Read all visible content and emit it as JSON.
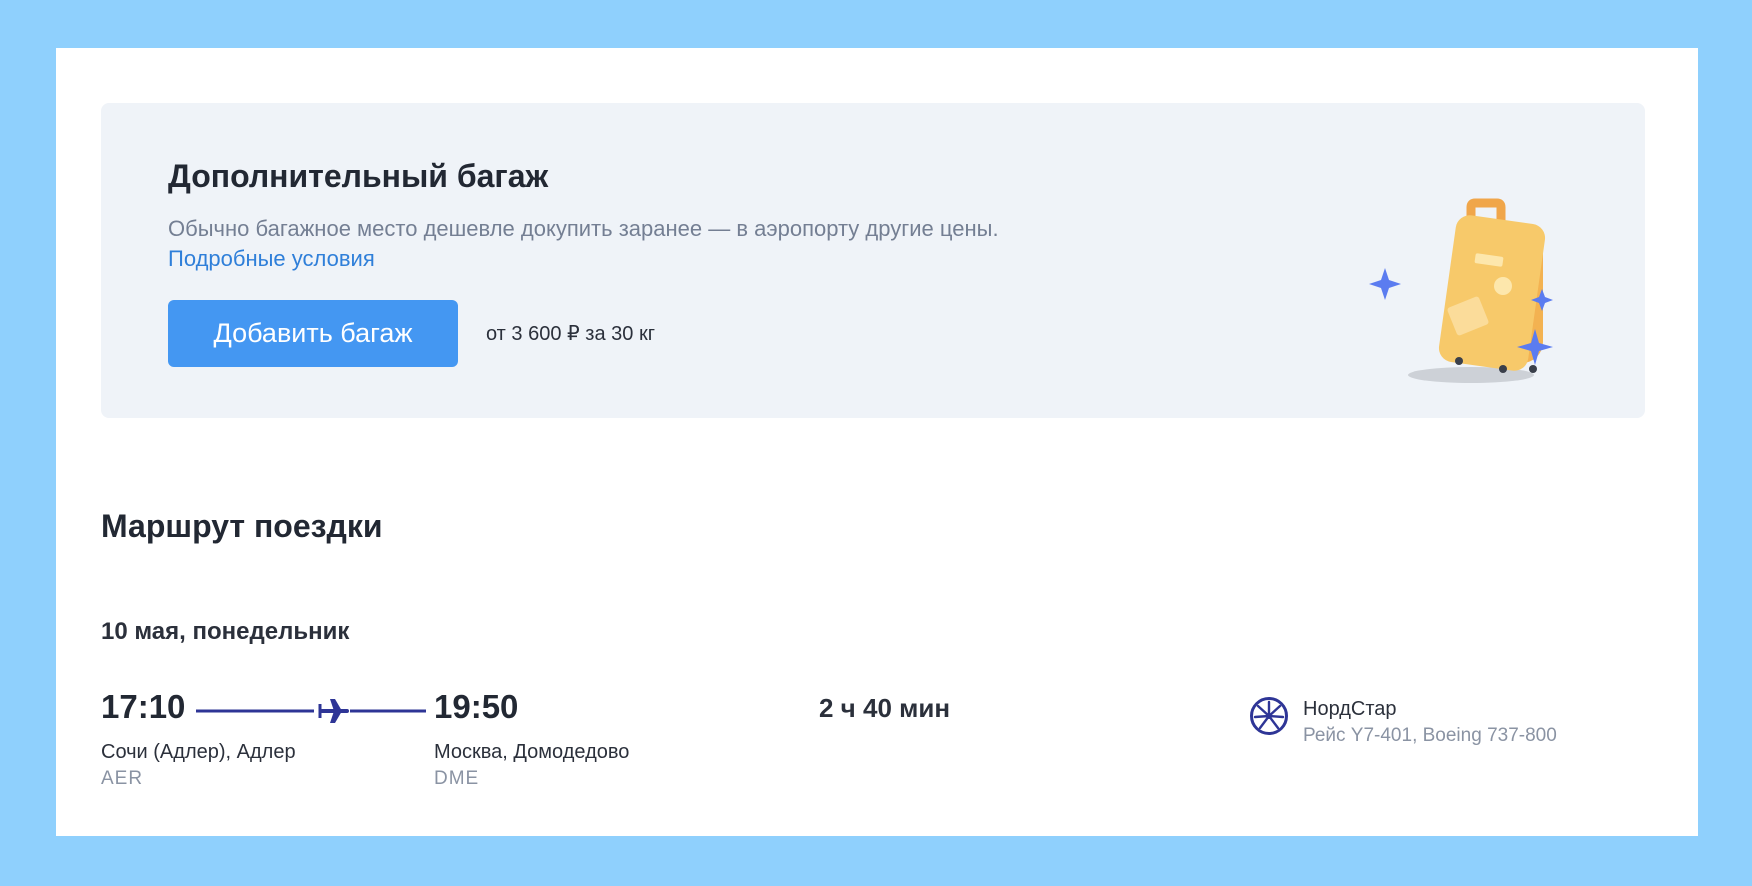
{
  "baggage": {
    "title": "Дополнительный багаж",
    "description": "Обычно багажное место дешевле докупить заранее — в аэропорту другие цены.",
    "link_label": "Подробные условия",
    "button_label": "Добавить багаж",
    "price_text": "от 3 600 ₽ за 30 кг"
  },
  "route": {
    "title": "Маршрут поездки",
    "date": "10 мая, понедельник",
    "departure": {
      "time": "17:10",
      "city": "Сочи (Адлер), Адлер",
      "code": "AER"
    },
    "arrival": {
      "time": "19:50",
      "city": "Москва, Домодедово",
      "code": "DME"
    },
    "duration": "2 ч 40 мин",
    "airline": {
      "name": "НордСтар",
      "flight_info": "Рейс Y7-401, Boeing 737-800"
    }
  },
  "icons": {
    "suitcase": "suitcase-icon",
    "sparkles": "sparkle-icon",
    "plane": "plane-icon",
    "airline_logo": "airline-logo-icon"
  },
  "colors": {
    "page_background": "#8fd0fd",
    "panel_background": "#eff3f8",
    "button": "#4497f2",
    "link": "#2f7fd9",
    "route_line": "#2e3596",
    "sparkle": "#5b7cf0",
    "suitcase": "#f7c96a"
  }
}
